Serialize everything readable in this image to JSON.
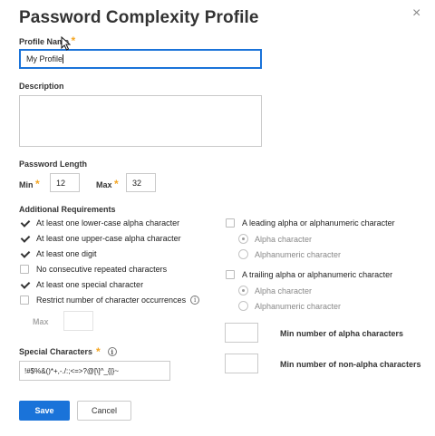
{
  "dialog": {
    "title": "Password Complexity Profile",
    "close_glyph": "×"
  },
  "profile_name": {
    "label": "Profile Name",
    "required": "*",
    "value": "My Profile"
  },
  "description": {
    "label": "Description",
    "value": ""
  },
  "password_length": {
    "label": "Password Length",
    "min_label": "Min",
    "min_required": "*",
    "min_value": "12",
    "max_label": "Max",
    "max_required": "*",
    "max_value": "32"
  },
  "requirements": {
    "label": "Additional Requirements",
    "items": [
      {
        "label": "At least one lower-case alpha character",
        "checked": true
      },
      {
        "label": "At least one upper-case alpha character",
        "checked": true
      },
      {
        "label": "At least one digit",
        "checked": true
      },
      {
        "label": "No consecutive repeated characters",
        "checked": false
      },
      {
        "label": "At least one special character",
        "checked": true
      },
      {
        "label": "Restrict number of character occurrences",
        "checked": false
      }
    ],
    "restrict_info_glyph": "i",
    "max_label": "Max",
    "max_value": ""
  },
  "leading": {
    "label": "A leading alpha or alphanumeric character",
    "checked": false,
    "options": [
      {
        "label": "Alpha character",
        "selected": true
      },
      {
        "label": "Alphanumeric character",
        "selected": false
      }
    ]
  },
  "trailing": {
    "label": "A trailing alpha or alphanumeric character",
    "checked": false,
    "options": [
      {
        "label": "Alpha character",
        "selected": true
      },
      {
        "label": "Alphanumeric character",
        "selected": false
      }
    ]
  },
  "min_alpha": {
    "label": "Min number of alpha characters",
    "value": ""
  },
  "min_non_alpha": {
    "label": "Min number of non-alpha characters",
    "value": ""
  },
  "special_chars": {
    "label": "Special Characters",
    "required": "*",
    "info_glyph": "i",
    "value": "!#$%&()*+,-./:;<=>?@[\\]^_{|}~"
  },
  "buttons": {
    "save": "Save",
    "cancel": "Cancel"
  },
  "colors": {
    "primary": "#1a73d9",
    "required": "#f5a623"
  }
}
